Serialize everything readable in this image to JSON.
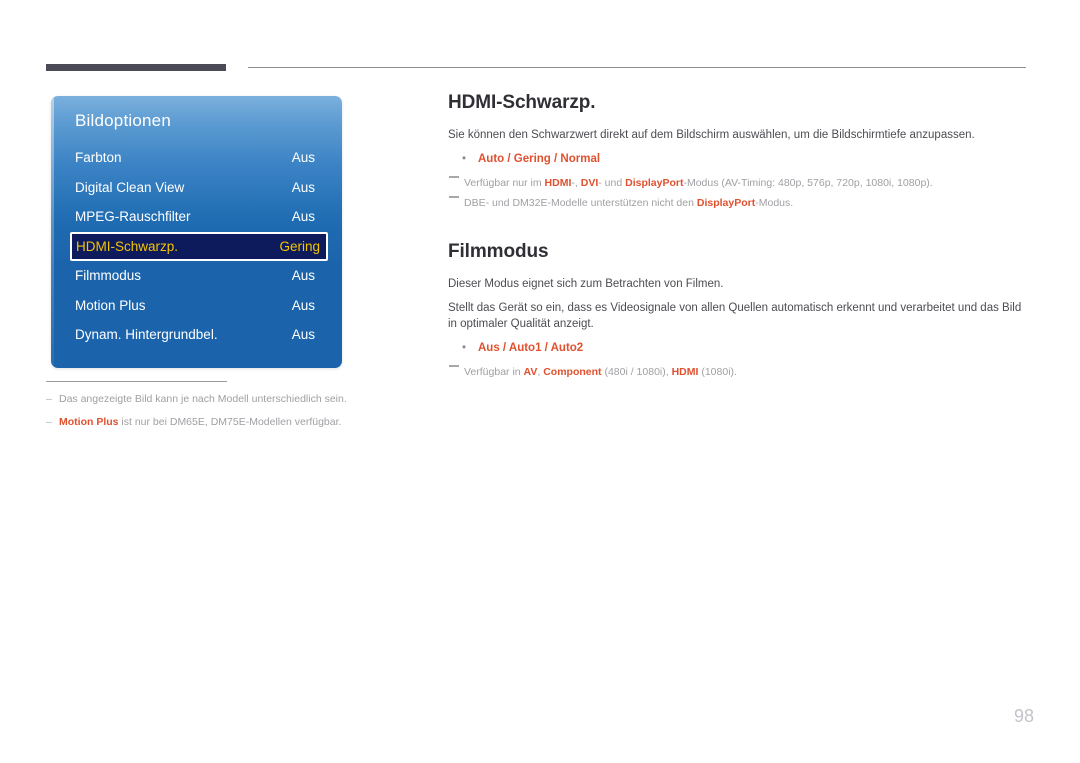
{
  "page": {
    "number": "98"
  },
  "osd": {
    "title": "Bildoptionen",
    "rows": [
      {
        "label": "Farbton",
        "value": "Aus",
        "selected": false
      },
      {
        "label": "Digital Clean View",
        "value": "Aus",
        "selected": false
      },
      {
        "label": "MPEG-Rauschfilter",
        "value": "Aus",
        "selected": false
      },
      {
        "label": "HDMI-Schwarzp.",
        "value": "Gering",
        "selected": true
      },
      {
        "label": "Filmmodus",
        "value": "Aus",
        "selected": false
      },
      {
        "label": "Motion Plus",
        "value": "Aus",
        "selected": false
      },
      {
        "label": "Dynam. Hintergrundbel.",
        "value": "Aus",
        "selected": false
      }
    ],
    "colors": {
      "panel_blue": "#1b64ac",
      "panel_top_blue": "#7bb0dd",
      "selected_fill": "#0d1a5c",
      "selected_text": "#f5c400",
      "selected_border": "#ffffff"
    }
  },
  "footnotes": {
    "dash": "–",
    "items": [
      {
        "bold": "",
        "text": "Das angezeigte Bild kann je nach Modell unterschiedlich sein."
      },
      {
        "bold": "Motion Plus",
        "text": " ist nur bei DM65E, DM75E-Modellen verfügbar."
      }
    ]
  },
  "sections": [
    {
      "title": "HDMI-Schwarzp.",
      "paragraphs": [
        "Sie können den Schwarzwert direkt auf dem Bildschirm auswählen, um die Bildschirmtiefe anzupassen."
      ],
      "bullet": {
        "marker": "•",
        "options": "Auto / Gering / Normal"
      },
      "notes": [
        {
          "parts": [
            {
              "t": "Verfügbar nur im ",
              "b": false
            },
            {
              "t": "HDMI",
              "b": true
            },
            {
              "t": "-, ",
              "b": false
            },
            {
              "t": "DVI",
              "b": true
            },
            {
              "t": "- und ",
              "b": false
            },
            {
              "t": "DisplayPort",
              "b": true
            },
            {
              "t": "-Modus (AV-Timing: 480p, 576p, 720p, 1080i, 1080p).",
              "b": false
            }
          ]
        },
        {
          "parts": [
            {
              "t": "DBE- und DM32E-Modelle unterstützen nicht den ",
              "b": false
            },
            {
              "t": "DisplayPort",
              "b": true
            },
            {
              "t": "-Modus.",
              "b": false
            }
          ]
        }
      ]
    },
    {
      "title": "Filmmodus",
      "paragraphs": [
        "Dieser Modus eignet sich zum Betrachten von Filmen.",
        "Stellt das Gerät so ein, dass es Videosignale von allen Quellen automatisch erkennt und verarbeitet und das Bild in optimaler Qualität anzeigt."
      ],
      "bullet": {
        "marker": "•",
        "options": "Aus / Auto1 / Auto2"
      },
      "notes": [
        {
          "parts": [
            {
              "t": "Verfügbar in ",
              "b": false
            },
            {
              "t": "AV",
              "b": true
            },
            {
              "t": ", ",
              "b": false
            },
            {
              "t": "Component",
              "b": true
            },
            {
              "t": " (480i / 1080i), ",
              "b": false
            },
            {
              "t": "HDMI",
              "b": true
            },
            {
              "t": " (1080i).",
              "b": false
            }
          ]
        }
      ]
    }
  ],
  "theme": {
    "accent_orange": "#e0512f",
    "heading_dark": "#2f2f35",
    "body_gray": "#4c4c52",
    "note_gray": "#a0a0a4",
    "rule_dark": "#4b4b57"
  }
}
